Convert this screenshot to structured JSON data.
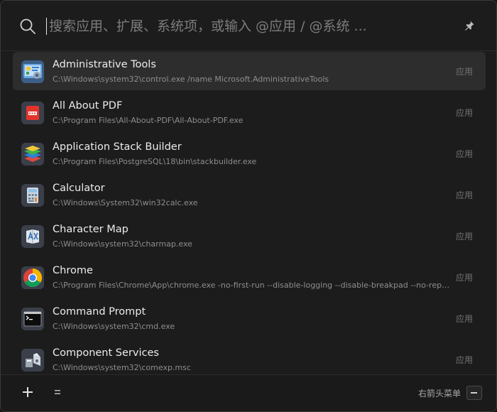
{
  "search": {
    "placeholder": "搜索应用、扩展、系统项，或输入 @应用 / @系统 ..."
  },
  "results": [
    {
      "name": "Administrative Tools",
      "path": "C:\\Windows\\system32\\control.exe /name Microsoft.AdministrativeTools",
      "type": "应用",
      "icon": "administrative-tools-icon",
      "selected": true
    },
    {
      "name": "All About PDF",
      "path": "C:\\Program Files\\All-About-PDF\\All-About-PDF.exe",
      "type": "应用",
      "icon": "pdf-icon"
    },
    {
      "name": "Application Stack Builder",
      "path": "C:\\Program Files\\PostgreSQL\\18\\bin\\stackbuilder.exe",
      "type": "应用",
      "icon": "stack-builder-icon"
    },
    {
      "name": "Calculator",
      "path": "C:\\Windows\\System32\\win32calc.exe",
      "type": "应用",
      "icon": "calculator-icon"
    },
    {
      "name": "Character Map",
      "path": "C:\\Windows\\system32\\charmap.exe",
      "type": "应用",
      "icon": "character-map-icon"
    },
    {
      "name": "Chrome",
      "path": "C:\\Program Files\\Chrome\\App\\chrome.exe -no-first-run --disable-logging --disable-breakpad --no-report-upload",
      "type": "应用",
      "icon": "chrome-icon"
    },
    {
      "name": "Command Prompt",
      "path": "C:\\Windows\\system32\\cmd.exe",
      "type": "应用",
      "icon": "command-prompt-icon"
    },
    {
      "name": "Component Services",
      "path": "C:\\Windows\\system32\\comexp.msc",
      "type": "应用",
      "icon": "component-services-icon"
    }
  ],
  "footer": {
    "hint": "右箭头菜单"
  },
  "colors": {
    "background": "#1c1c1c",
    "selected_row": "#2d2d2d",
    "pdf_red": "#e2342b"
  }
}
